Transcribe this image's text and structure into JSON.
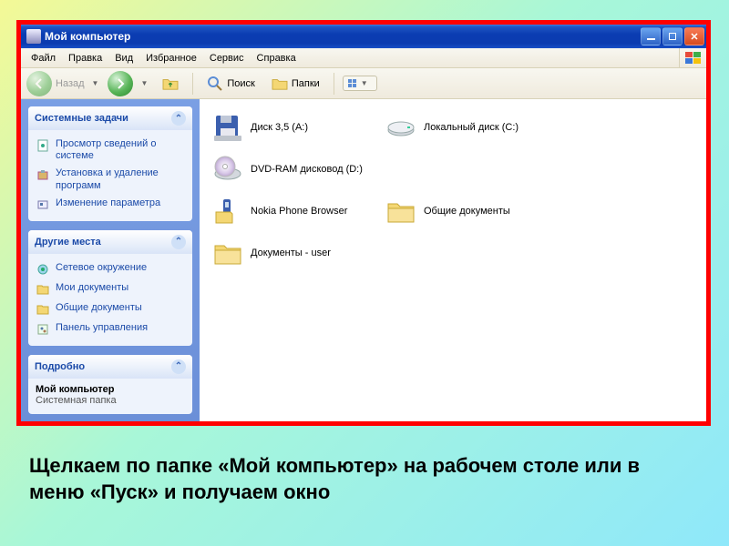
{
  "titlebar": {
    "title": "Мой компьютер"
  },
  "menu": [
    "Файл",
    "Правка",
    "Вид",
    "Избранное",
    "Сервис",
    "Справка"
  ],
  "toolbar": {
    "back_label": "Назад",
    "search_label": "Поиск",
    "folders_label": "Папки"
  },
  "sidebar": {
    "panel1": {
      "title": "Системные задачи",
      "items": [
        "Просмотр сведений о системе",
        "Установка и удаление программ",
        "Изменение параметра"
      ]
    },
    "panel2": {
      "title": "Другие места",
      "items": [
        "Сетевое окружение",
        "Мои документы",
        "Общие документы",
        "Панель управления"
      ]
    },
    "panel3": {
      "title": "Подробно",
      "name": "Мой компьютер",
      "type": "Системная папка"
    }
  },
  "items": [
    {
      "label": "Диск 3,5 (A:)",
      "icon": "floppy"
    },
    {
      "label": "Локальный диск (C:)",
      "icon": "hdd"
    },
    {
      "label": "DVD-RAM дисковод (D:)",
      "icon": "cd"
    },
    {
      "label": "Nokia Phone Browser",
      "icon": "phone"
    },
    {
      "label": "Общие документы",
      "icon": "folder"
    },
    {
      "label": "Документы - user",
      "icon": "folder"
    }
  ],
  "caption": "Щелкаем по папке «Мой компьютер» на рабочем столе или в меню «Пуск» и получаем окно"
}
